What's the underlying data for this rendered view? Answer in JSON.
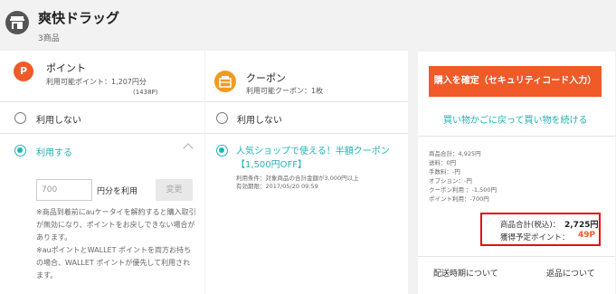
{
  "store": {
    "name": "爽快ドラッグ",
    "count": "3商品"
  },
  "point": {
    "icon_letter": "P",
    "title": "ポイント",
    "available": "利用可能ポイント：1,207円分",
    "available_sub": "(1438P)",
    "option_none": "利用しない",
    "option_use": "利用する",
    "input_value": "700",
    "use_label": "円分を利用",
    "change_button": "変更",
    "note1": "※商品到着前にauケータイを解約すると購入取引が無効になり、ポイントをお戻しできない場合があります。",
    "note2": "※auポイントとWALLET ポイントを両方お持ちの場合、WALLET ポイントが優先して利用されます。"
  },
  "coupon": {
    "title": "クーポン",
    "available": "利用可能クーポン：1枚",
    "option_none": "利用しない",
    "offer": "人気ショップで使える！半額クーポン【1,500円OFF】",
    "condition": "利用条件：対象商品の合計金額が3,000円以上",
    "expiry": "有効期限：2017/05/20 09:59"
  },
  "summary": {
    "confirm_button": "購入を確定（セキュリティコード入力）",
    "back_link": "買い物かごに戻って買い物を続ける",
    "fees": [
      "商品合計：4,925円",
      "送料：0円",
      "手数料：-円",
      "オプション：-円",
      "クーポン利用 ：-1,500円",
      "ポイント利用：-700円"
    ],
    "total_label": "商品合計(税込)：",
    "total_value": "2,725円",
    "points_label": "獲得予定ポイント：",
    "points_value": "49P",
    "delivery_link": "配送時期について",
    "return_link": "返品について"
  },
  "colors": {
    "accent": "#ef5a28",
    "teal": "#21b3b3",
    "coupon_icon": "#f29a1f",
    "highlight_border": "#e01010"
  },
  "icons": {
    "store": "store-icon",
    "point": "point-icon",
    "coupon": "coupon-icon",
    "chevron": "chevron-up-icon"
  }
}
